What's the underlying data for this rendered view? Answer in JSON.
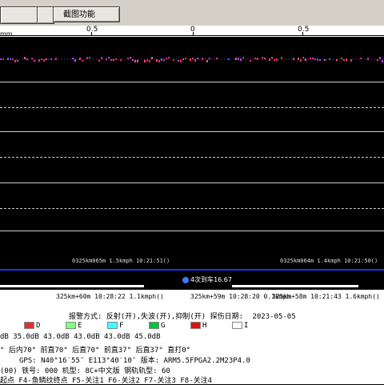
{
  "toolbar": {
    "screenshot_btn": "截图功能"
  },
  "ruler": {
    "unit": "mm",
    "labels": [
      "0.5",
      "0",
      "0.5"
    ]
  },
  "track": {
    "left_marker": "0325km065m 1.5kmph 10:21:51()",
    "right_marker": "0325km064m 1.4kmph 10:21:50()"
  },
  "alarm": {
    "text": "4次到车16.67",
    "dot_color": "#3a7cff"
  },
  "info": {
    "pos_left": "325km+60m 10:28:22 1.1kmph()",
    "pos_mid": "325km+59m 10:28:20 0.1kmph",
    "pos_right": "325km+58m 10:21:43 1.6kmph()",
    "mode_line": "报警方式: 反射(开),失波(开),抑制(开) 探伤日期:",
    "date": "2023-05-05",
    "channels": [
      {
        "label": "D",
        "color": "#e03030"
      },
      {
        "label": "E",
        "color": "#80ff80"
      },
      {
        "label": "F",
        "color": "#40ffff"
      },
      {
        "label": "G",
        "color": "#00c040"
      },
      {
        "label": "H",
        "color": "#e01010"
      },
      {
        "label": "I",
        "color": "#ffffff"
      }
    ],
    "db_line": "dB    35.0dB    43.0dB    43.0dB    43.0dB    45.0dB",
    "angle_line": "°   后内70°   前直70°   后直70°   前直37°   后直37°   直打0°",
    "gps_line": "GPS:  N40°16′55″   E113°40′10″ 版本: ARM5.5FPGA2.2M23P4.0",
    "id_line": "(00)    铁号: 000          机型: 8C+中文版   钢轨轨型: 60",
    "fkeys": "起点  F4-鱼鳞纹终点  F5-关注1   F6-关注2  F7-关注3  F8-关注4"
  }
}
